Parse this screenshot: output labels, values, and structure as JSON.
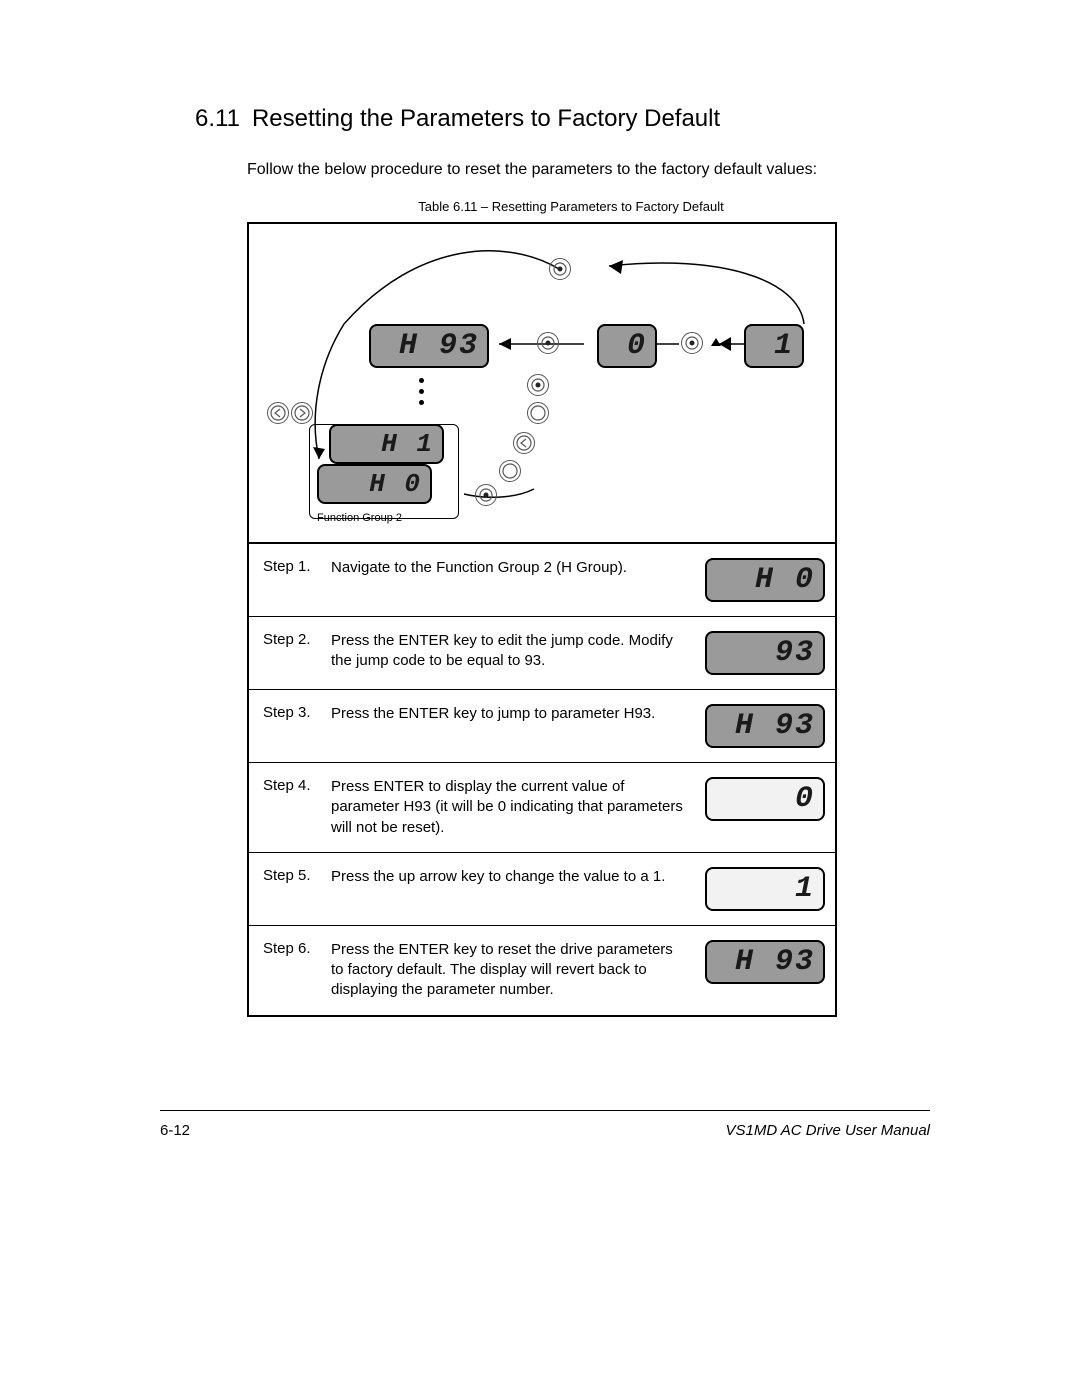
{
  "section_number": "6.11",
  "section_title": "Resetting the Parameters to Factory Default",
  "intro": "Follow the below procedure to reset the parameters to the factory default values:",
  "table_caption": "Table 6.11 – Resetting Parameters to Factory Default",
  "diagram": {
    "displays": {
      "h93": "H 93",
      "zero": "0",
      "one": "1",
      "h1": "H  1",
      "h0": "H  0"
    },
    "function_group_label": "Function Group 2"
  },
  "steps": [
    {
      "label": "Step 1.",
      "text": "Navigate to the Function Group 2 (H Group).",
      "display": "H  0",
      "bg": "dark"
    },
    {
      "label": "Step 2.",
      "text": "Press the ENTER key to edit the jump code. Modify the jump code to be equal to 93.",
      "display": "93",
      "bg": "dark"
    },
    {
      "label": "Step 3.",
      "text": "Press the ENTER key to jump to parameter H93.",
      "display": "H 93",
      "bg": "dark"
    },
    {
      "label": "Step 4.",
      "text": "Press ENTER to display the current value of parameter H93 (it will be 0 indicating that parameters will not be reset).",
      "display": "0",
      "bg": "light"
    },
    {
      "label": "Step 5.",
      "text": "Press the up arrow key to change the value to a 1.",
      "display": "1",
      "bg": "light"
    },
    {
      "label": "Step 6.",
      "text": "Press the ENTER key to reset the drive parameters to factory default. The display will revert back to displaying the parameter number.",
      "display": "H 93",
      "bg": "dark"
    }
  ],
  "footer": {
    "page": "6-12",
    "manual": "VS1MD AC Drive User Manual"
  }
}
